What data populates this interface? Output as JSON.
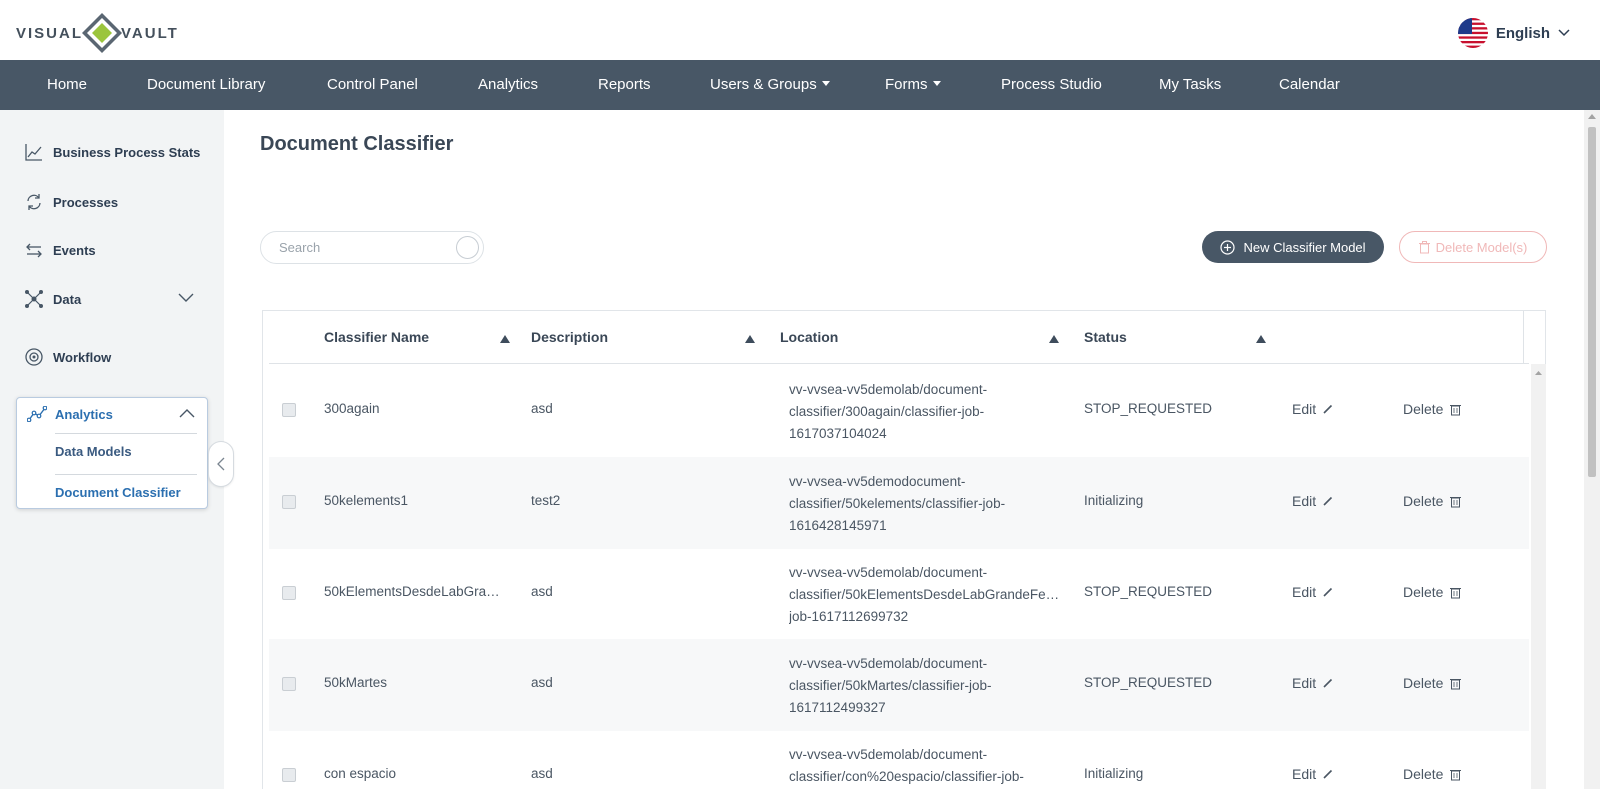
{
  "brand": {
    "left": "VISUAL",
    "right": "VAULT"
  },
  "language": {
    "label": "English"
  },
  "nav": {
    "items": [
      {
        "label": "Home",
        "dropdown": false
      },
      {
        "label": "Document Library",
        "dropdown": false
      },
      {
        "label": "Control Panel",
        "dropdown": false
      },
      {
        "label": "Analytics",
        "dropdown": false
      },
      {
        "label": "Reports",
        "dropdown": false
      },
      {
        "label": "Users & Groups",
        "dropdown": true
      },
      {
        "label": "Forms",
        "dropdown": true
      },
      {
        "label": "Process Studio",
        "dropdown": false
      },
      {
        "label": "My Tasks",
        "dropdown": false
      },
      {
        "label": "Calendar",
        "dropdown": false
      }
    ]
  },
  "sidebar": {
    "items": [
      {
        "label": "Business Process Stats",
        "icon": "chart-line-icon"
      },
      {
        "label": "Processes",
        "icon": "sync-icon"
      },
      {
        "label": "Events",
        "icon": "arrows-icon"
      },
      {
        "label": "Data",
        "icon": "data-nodes-icon"
      },
      {
        "label": "Workflow",
        "icon": "workflow-icon"
      }
    ],
    "analytics": {
      "label": "Analytics",
      "links": [
        {
          "label": "Data Models",
          "active": false
        },
        {
          "label": "Document Classifier",
          "active": true
        }
      ]
    }
  },
  "main": {
    "title": "Document Classifier",
    "search_placeholder": "Search",
    "new_button": "New Classifier Model",
    "delete_button": "Delete Model(s)"
  },
  "table": {
    "columns": [
      "Classifier Name",
      "Description",
      "Location",
      "Status"
    ],
    "edit_label": "Edit",
    "delete_label": "Delete",
    "rows": [
      {
        "name": "300again",
        "description": "asd",
        "location": [
          "vv-vvsea-vv5demolab/document-",
          "classifier/300again/classifier-job-",
          "1617037104024"
        ],
        "status": "STOP_REQUESTED"
      },
      {
        "name": "50kelements1",
        "description": "test2",
        "location": [
          "vv-vvsea-vv5demodocument-",
          "classifier/50kelements/classifier-job-",
          "1616428145971"
        ],
        "status": "Initializing"
      },
      {
        "name": "50kElementsDesdeLabGra…",
        "description": "asd",
        "location": [
          "vv-vvsea-vv5demolab/document-",
          "classifier/50kElementsDesdeLabGrandeFe…",
          "job-1617112699732"
        ],
        "status": "STOP_REQUESTED"
      },
      {
        "name": "50kMartes",
        "description": "asd",
        "location": [
          "vv-vvsea-vv5demolab/document-",
          "classifier/50kMartes/classifier-job-",
          "1617112499327"
        ],
        "status": "STOP_REQUESTED"
      },
      {
        "name": "con espacio",
        "description": "asd",
        "location": [
          "vv-vvsea-vv5demolab/document-",
          "classifier/con%20espacio/classifier-job-",
          ""
        ],
        "status": "Initializing"
      }
    ]
  },
  "colors": {
    "nav_bg": "#485766",
    "accent": "#2b6fb0",
    "danger_light": "#f0b8b8",
    "brand_green": "#9bc53d"
  }
}
